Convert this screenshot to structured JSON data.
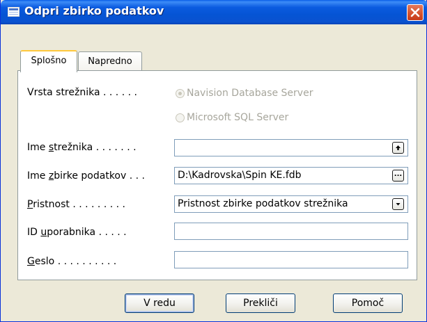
{
  "window": {
    "title": "Odpri zbirko podatkov",
    "icon": "database-window-icon",
    "close_icon": "close-icon"
  },
  "tabs": [
    {
      "label": "Splošno",
      "active": true
    },
    {
      "label": "Napredno",
      "active": false
    }
  ],
  "form": {
    "server_type": {
      "label": "Vrsta strežnika",
      "dots": ". . . . . .",
      "options": [
        {
          "label": "Navision Database Server",
          "selected": true,
          "disabled": true
        },
        {
          "label": "Microsoft SQL Server",
          "selected": false,
          "disabled": true
        }
      ]
    },
    "server_name": {
      "label_before": "Ime ",
      "label_u": "s",
      "label_after": "trežnika",
      "dots": ". . . . . . .",
      "value": "",
      "button_icon": "up-arrow-icon"
    },
    "database_name": {
      "label_before": "Ime ",
      "label_u": "z",
      "label_after": "birke podatkov",
      "dots": ". . .",
      "value": "D:\\Kadrovska\\Spin KE.fdb",
      "button_icon": "ellipsis-icon",
      "button_text": "..."
    },
    "authentication": {
      "label_u": "P",
      "label_after": "ristnost",
      "dots": ". . . . . . . . .",
      "value": "Pristnost zbirke podatkov strežnika",
      "button_icon": "chevron-down-icon"
    },
    "user_id": {
      "label_before": "ID ",
      "label_u": "u",
      "label_after": "porabnika",
      "dots": ". . . . .",
      "value": ""
    },
    "password": {
      "label_u": "G",
      "label_after": "eslo",
      "dots": ". . . . . . . . . .",
      "value": ""
    }
  },
  "buttons": {
    "ok": "V redu",
    "cancel": "Prekliči",
    "help": "Pomoč"
  },
  "colors": {
    "titlebar": "#0554D4",
    "dialog_bg": "#ECE9D8",
    "field_border": "#7F9DB9",
    "tab_accent": "#FFC83C",
    "close_button": "#D4512C"
  }
}
